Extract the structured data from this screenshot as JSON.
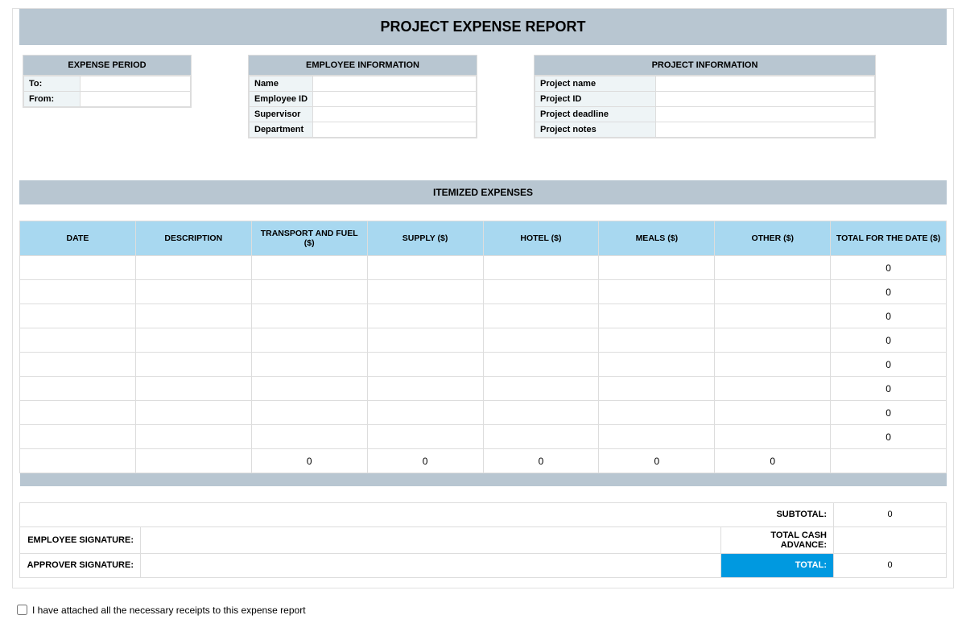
{
  "title": "PROJECT EXPENSE REPORT",
  "expensePeriod": {
    "header": "EXPENSE PERIOD",
    "rows": [
      {
        "label": "To:",
        "value": ""
      },
      {
        "label": "From:",
        "value": ""
      }
    ]
  },
  "employeeInfo": {
    "header": "EMPLOYEE INFORMATION",
    "rows": [
      {
        "label": "Name",
        "value": ""
      },
      {
        "label": "Employee ID",
        "value": ""
      },
      {
        "label": "Supervisor",
        "value": ""
      },
      {
        "label": "Department",
        "value": ""
      }
    ]
  },
  "projectInfo": {
    "header": "PROJECT INFORMATION",
    "rows": [
      {
        "label": "Project name",
        "value": ""
      },
      {
        "label": "Project ID",
        "value": ""
      },
      {
        "label": "Project deadline",
        "value": ""
      },
      {
        "label": "Project notes",
        "value": ""
      }
    ]
  },
  "itemized": {
    "header": "ITEMIZED EXPENSES",
    "columns": [
      "DATE",
      "DESCRIPTION",
      "TRANSPORT AND FUEL ($)",
      "SUPPLY ($)",
      "HOTEL ($)",
      "MEALS ($)",
      "OTHER ($)",
      "TOTAL FOR THE DATE ($)"
    ],
    "rows": [
      {
        "date": "",
        "desc": "",
        "transport": "",
        "supply": "",
        "hotel": "",
        "meals": "",
        "other": "",
        "total": "0"
      },
      {
        "date": "",
        "desc": "",
        "transport": "",
        "supply": "",
        "hotel": "",
        "meals": "",
        "other": "",
        "total": "0"
      },
      {
        "date": "",
        "desc": "",
        "transport": "",
        "supply": "",
        "hotel": "",
        "meals": "",
        "other": "",
        "total": "0"
      },
      {
        "date": "",
        "desc": "",
        "transport": "",
        "supply": "",
        "hotel": "",
        "meals": "",
        "other": "",
        "total": "0"
      },
      {
        "date": "",
        "desc": "",
        "transport": "",
        "supply": "",
        "hotel": "",
        "meals": "",
        "other": "",
        "total": "0"
      },
      {
        "date": "",
        "desc": "",
        "transport": "",
        "supply": "",
        "hotel": "",
        "meals": "",
        "other": "",
        "total": "0"
      },
      {
        "date": "",
        "desc": "",
        "transport": "",
        "supply": "",
        "hotel": "",
        "meals": "",
        "other": "",
        "total": "0"
      },
      {
        "date": "",
        "desc": "",
        "transport": "",
        "supply": "",
        "hotel": "",
        "meals": "",
        "other": "",
        "total": "0"
      }
    ],
    "columnTotals": {
      "date": "",
      "desc": "",
      "transport": "0",
      "supply": "0",
      "hotel": "0",
      "meals": "0",
      "other": "0",
      "total": ""
    }
  },
  "summary": {
    "subtotalLabel": "SUBTOTAL:",
    "subtotalValue": "0",
    "empSigLabel": "EMPLOYEE SIGNATURE:",
    "cashAdvanceLabel": "TOTAL CASH ADVANCE:",
    "cashAdvanceValue": "",
    "approverSigLabel": "APPROVER SIGNATURE:",
    "totalLabel": "TOTAL:",
    "totalValue": "0"
  },
  "attestation": "I have attached all the necessary receipts to this expense report"
}
